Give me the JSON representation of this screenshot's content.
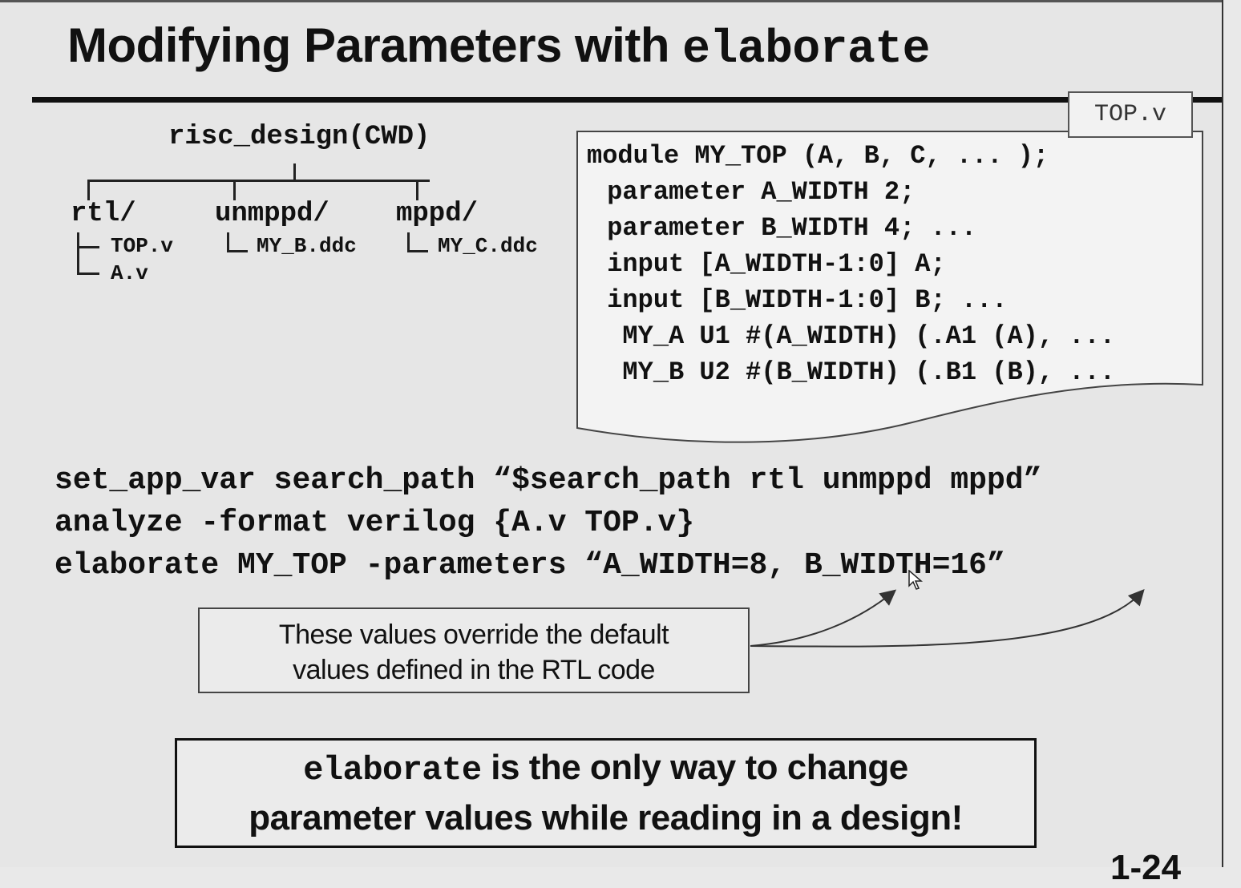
{
  "slide": {
    "title_text": "Modifying Parameters with ",
    "title_code": "elaborate",
    "page_number": "1-24"
  },
  "tree": {
    "root": "risc_design(CWD)",
    "dirs": [
      {
        "name": "rtl/",
        "files": [
          "TOP.v",
          "A.v"
        ]
      },
      {
        "name": "unmppd/",
        "files": [
          "MY_B.ddc"
        ]
      },
      {
        "name": "mppd/",
        "files": [
          "MY_C.ddc"
        ]
      }
    ]
  },
  "code_file": {
    "filename": "TOP.v",
    "lines": [
      "module MY_TOP (A, B, C, ... );",
      " parameter A_WIDTH 2;",
      " parameter B_WIDTH 4; ...",
      " input [A_WIDTH-1:0] A;",
      " input [B_WIDTH-1:0] B; ...",
      "  MY_A U1 #(A_WIDTH) (.A1 (A), ...",
      "  MY_B U2 #(B_WIDTH) (.B1 (B), ..."
    ]
  },
  "commands": [
    "set_app_var search_path “$search_path rtl unmppd mppd”",
    "analyze -format verilog {A.v TOP.v}",
    "elaborate MY_TOP -parameters “A_WIDTH=8, B_WIDTH=16”"
  ],
  "callout": {
    "line1": "These values override the default",
    "line2": "values defined in the RTL code"
  },
  "note": {
    "code": "elaborate",
    "rest1": " is the only way to change",
    "line2": "parameter values while reading in a design!"
  }
}
